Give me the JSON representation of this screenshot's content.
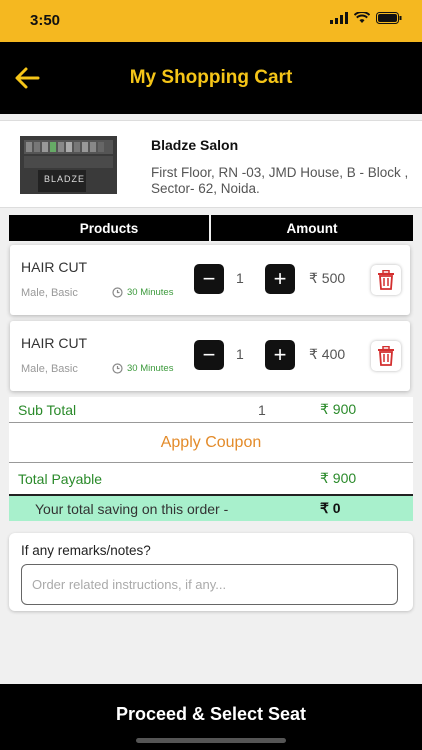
{
  "status_bar": {
    "time": "3:50"
  },
  "header": {
    "title": "My Shopping Cart"
  },
  "salon": {
    "name": "Bladze Salon",
    "address": "First Floor, RN -03, JMD House, B - Block , Sector- 62, Noida.",
    "logo_text": "BLADZE"
  },
  "table_headers": {
    "products": "Products",
    "amount": "Amount"
  },
  "items": [
    {
      "service": "HAIR CUT",
      "meta": "Male, Basic",
      "duration": "30 Minutes",
      "minus": "−",
      "quantity": "1",
      "plus": "+",
      "price": "₹ 500"
    },
    {
      "service": "HAIR CUT",
      "meta": "Male, Basic",
      "duration": "30 Minutes",
      "minus": "−",
      "quantity": "1",
      "plus": "+",
      "price": "₹ 400"
    }
  ],
  "summary": {
    "subtotal_label": "Sub Total",
    "subtotal_count": "1",
    "subtotal_amount": "₹ 900",
    "coupon_label": "Apply Coupon",
    "total_label": "Total Payable",
    "total_amount": "₹ 900",
    "saving_label": "Your total saving on this order -",
    "saving_amount": "₹ 0"
  },
  "remarks": {
    "question": "If any remarks/notes?",
    "placeholder": "Order related instructions, if any...",
    "value": ""
  },
  "footer": {
    "button_label": "Proceed & Select Seat"
  },
  "colors": {
    "accent": "#f5c518",
    "status_bar": "#f5b820",
    "green": "#2a8a2a",
    "saving_bg": "#a8f0cc",
    "coupon": "#e38b2a"
  }
}
